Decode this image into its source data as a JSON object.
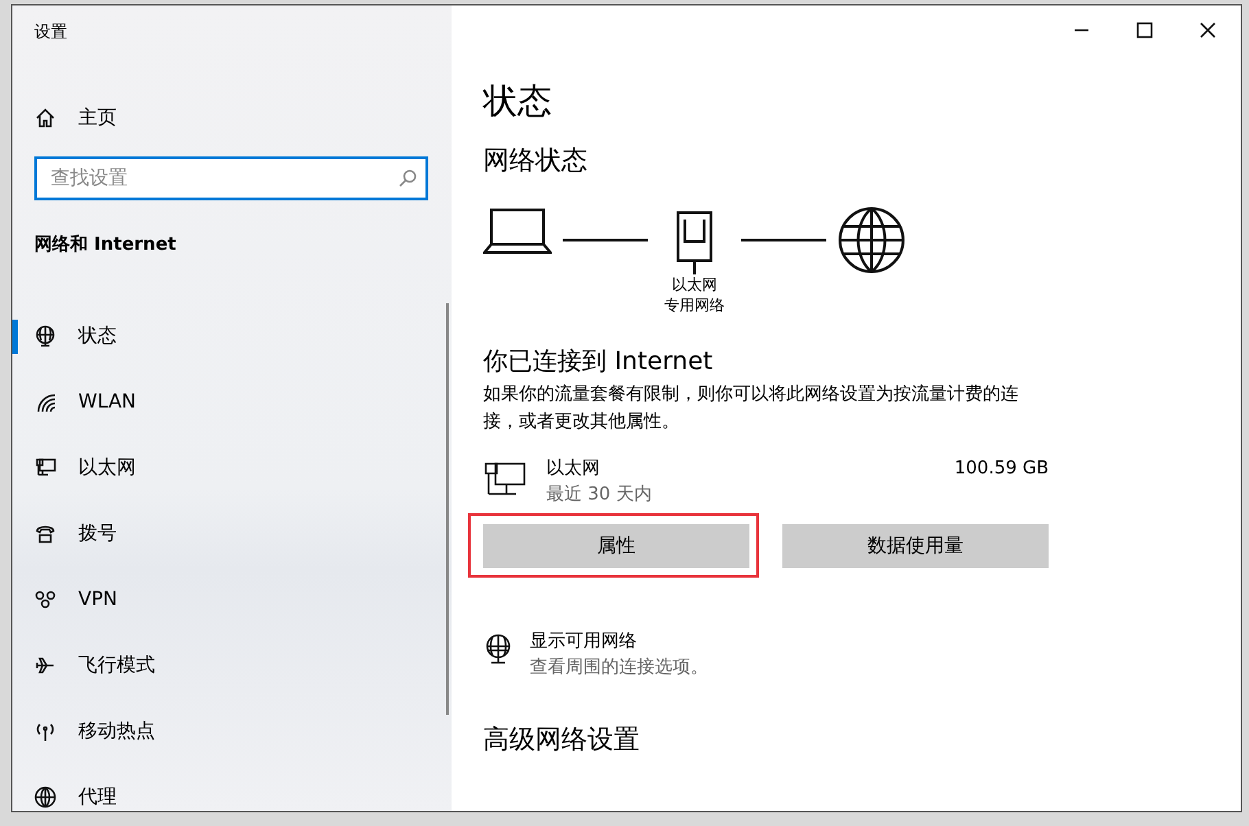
{
  "window": {
    "title": "设置"
  },
  "sidebar": {
    "home": "主页",
    "search": {
      "placeholder": "查找设置"
    },
    "section": "网络和 Internet",
    "items": [
      {
        "label": "状态",
        "selected": true
      },
      {
        "label": "WLAN",
        "selected": false
      },
      {
        "label": "以太网",
        "selected": false
      },
      {
        "label": "拨号",
        "selected": false
      },
      {
        "label": "VPN",
        "selected": false
      },
      {
        "label": "飞行模式",
        "selected": false
      },
      {
        "label": "移动热点",
        "selected": false
      },
      {
        "label": "代理",
        "selected": false
      }
    ]
  },
  "main": {
    "title": "状态",
    "network_status": {
      "heading": "网络状态",
      "adapter_label": "以太网",
      "network_type": "专用网络"
    },
    "connection": {
      "heading": "你已连接到 Internet",
      "description": "如果你的流量套餐有限制，则你可以将此网络设置为按流量计费的连接，或者更改其他属性。"
    },
    "adapter": {
      "name": "以太网",
      "period": "最近 30 天内",
      "usage": "100.59 GB"
    },
    "buttons": [
      {
        "label": "属性",
        "highlighted": true
      },
      {
        "label": "数据使用量",
        "highlighted": false
      }
    ],
    "show_networks": {
      "title": "显示可用网络",
      "subtitle": "查看周围的连接选项。"
    },
    "advanced_heading": "高级网络设置"
  }
}
